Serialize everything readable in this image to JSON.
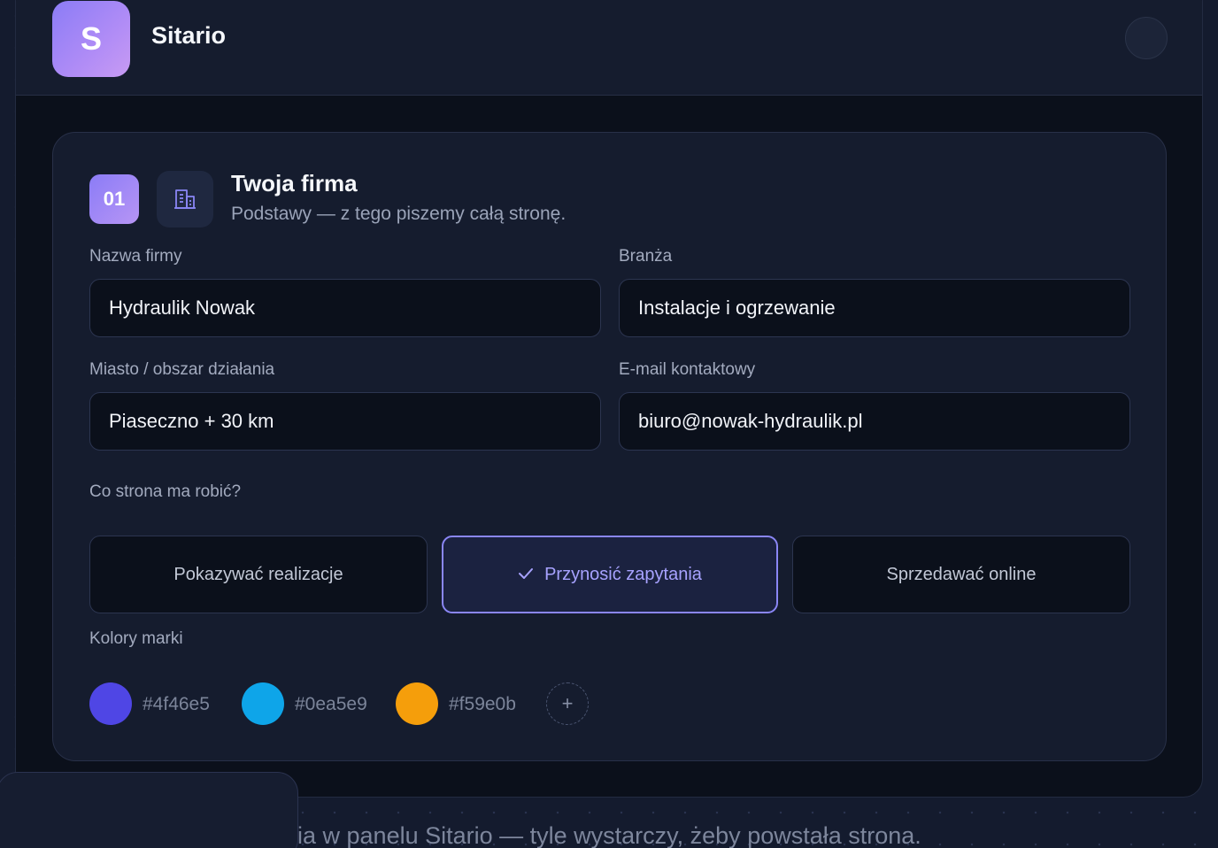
{
  "topbar": {
    "logo_letter": "S",
    "brand_name": "Sitario"
  },
  "section": {
    "step_number": "01",
    "icon": "building-icon",
    "title": "Twoja firma",
    "subtitle": "Podstawy — z tego piszemy całą stronę."
  },
  "fields": {
    "company_name": {
      "label": "Nazwa firmy",
      "value": "Hydraulik Nowak"
    },
    "industry": {
      "label": "Branża",
      "value": "Instalacje i ogrzewanie"
    },
    "city": {
      "label": "Miasto / obszar działania",
      "value": "Piaseczno + 30 km"
    },
    "email": {
      "label": "E-mail kontaktowy",
      "value": "biuro@nowak-hydraulik.pl"
    }
  },
  "goals": {
    "label": "Co strona ma robić?",
    "options": [
      {
        "label": "Pokazywać realizacje",
        "selected": false
      },
      {
        "label": "Przynosić zapytania",
        "selected": true
      },
      {
        "label": "Sprzedawać online",
        "selected": false
      }
    ]
  },
  "brand_colors": {
    "label": "Kolory marki",
    "swatches": [
      {
        "hex": "#4f46e5"
      },
      {
        "hex": "#0ea5e9"
      },
      {
        "hex": "#f59e0b"
      }
    ],
    "add_label": "+"
  },
  "footer": {
    "text": "ia w panelu Sitario — tyle wystarczy, żeby powstała strona."
  },
  "colors": {
    "accent": "#8a86f5",
    "card_bg": "#151c2e",
    "input_bg": "#0b101b"
  }
}
